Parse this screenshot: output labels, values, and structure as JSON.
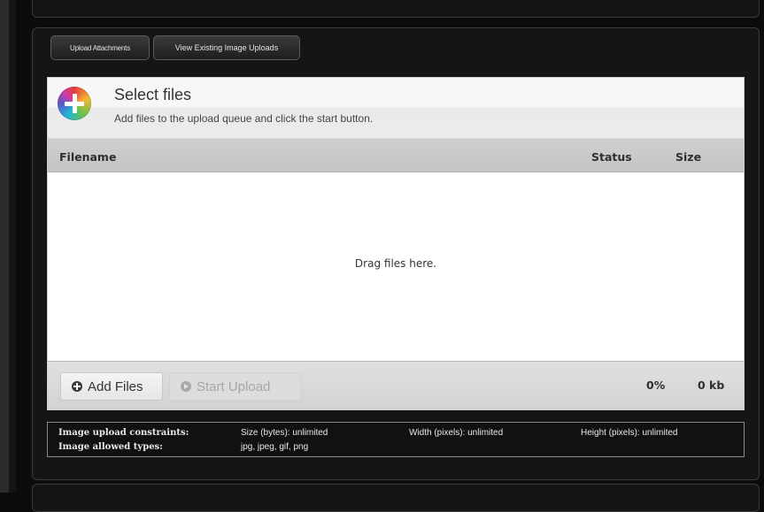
{
  "tabs": [
    {
      "label": "Upload Attachments"
    },
    {
      "label": "View Existing Image Uploads"
    }
  ],
  "uploader": {
    "title": "Select files",
    "subtitle": "Add files to the upload queue and click the start button.",
    "columns": {
      "filename": "Filename",
      "status": "Status",
      "size": "Size"
    },
    "drop_text": "Drag files here.",
    "add_files_label": "Add Files",
    "start_upload_label": "Start Upload",
    "total_percent": "0%",
    "total_size": "0 kb"
  },
  "constraints": {
    "constraints_label": "Image upload constraints:",
    "types_label": "Image allowed types:",
    "size_text": "Size (bytes):  unlimited",
    "width_text": "Width (pixels):  unlimited",
    "height_text": "Height (pixels):  unlimited",
    "types_value": "jpg, jpeg, gif, png"
  },
  "colors": {
    "background": "#0c0c0c",
    "panel": "#151515",
    "header_bar": "#c9c9c9"
  },
  "icons": {
    "select_files": "color-plus-icon",
    "add_files": "plus-circle-icon",
    "start_upload": "play-circle-icon"
  }
}
